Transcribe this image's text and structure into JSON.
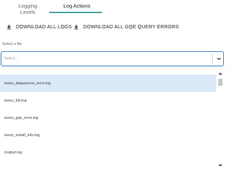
{
  "tabs": [
    {
      "label": "Logging Levels",
      "active": false
    },
    {
      "label": "Log Actions",
      "active": true
    }
  ],
  "colors": {
    "accent": "#45a59e",
    "focus_border": "#3b80c8",
    "selected_row": "#dbe9f8"
  },
  "actions": {
    "download_all_logs": {
      "label": "DOWNLOAD ALL LOGS",
      "icon": "download-icon"
    },
    "download_gqe_errors": {
      "label": "DOWNLOAD ALL GQE QUERY ERRORS",
      "icon": "download-icon"
    }
  },
  "file_select": {
    "label": "Select a file",
    "placeholder": "Select...",
    "value": "",
    "icon": "chevron-down-icon"
  },
  "dropdown": {
    "options": [
      {
        "label": "/anzo_datasource_error.log",
        "selected": true
      },
      {
        "label": "/anzo_full.log",
        "selected": false
      },
      {
        "label": "/anzo_gqe_error.log",
        "selected": false
      },
      {
        "label": "/anzo_install_info.log",
        "selected": false
      },
      {
        "label": "/output.log",
        "selected": false
      }
    ]
  }
}
